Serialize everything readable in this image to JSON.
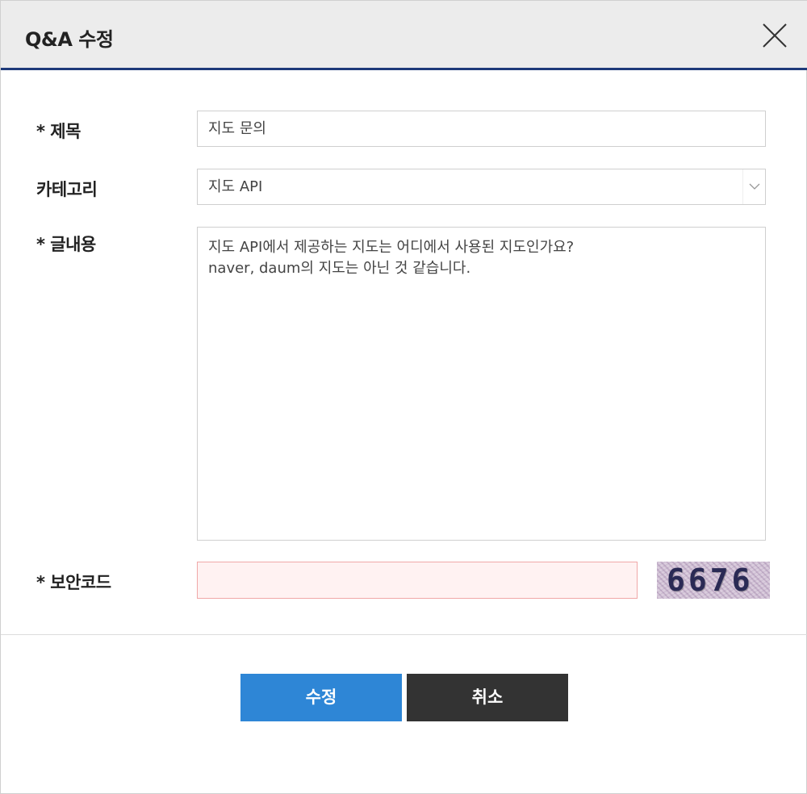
{
  "dialog": {
    "title": "Q&A 수정"
  },
  "form": {
    "title_label": "* 제목",
    "title_value": "지도 문의",
    "category_label": "카테고리",
    "category_value": "지도 API",
    "content_label": "* 글내용",
    "content_value": "지도 API에서 제공하는 지도는 어디에서 사용된 지도인가요?\nnaver, daum의 지도는 아닌 것 같습니다.",
    "captcha_label": "* 보안코드",
    "captcha_value": "",
    "captcha_code": "6676"
  },
  "buttons": {
    "submit_label": "수정",
    "cancel_label": "취소"
  },
  "colors": {
    "header_accent": "#1e3a7a",
    "submit_bg": "#2e86d6",
    "cancel_bg": "#333333",
    "captcha_input_bg": "#fff2f2"
  }
}
